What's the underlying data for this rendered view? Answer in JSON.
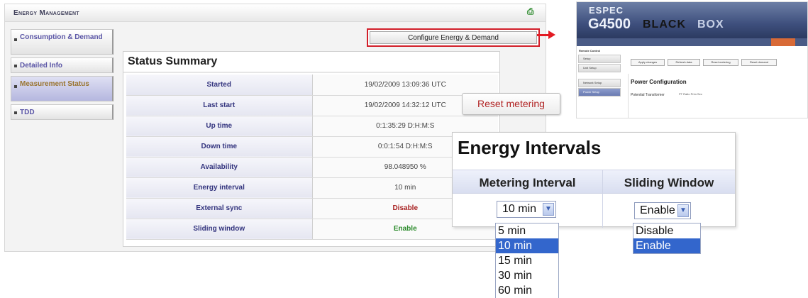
{
  "app": {
    "title": "Energy Management"
  },
  "sidebar": {
    "items": [
      {
        "label": "Consumption & Demand"
      },
      {
        "label": "Detailed Info"
      },
      {
        "label": "Measurement Status"
      },
      {
        "label": "TDD"
      }
    ]
  },
  "toolbar": {
    "configure_label": "Configure Energy & Demand"
  },
  "status_summary": {
    "title": "Status Summary",
    "rows": [
      {
        "label": "Started",
        "value": "19/02/2009 13:09:36 UTC"
      },
      {
        "label": "Last start",
        "value": "19/02/2009 14:32:12 UTC"
      },
      {
        "label": "Up time",
        "value": "0:1:35:29 D:H:M:S"
      },
      {
        "label": "Down time",
        "value": "0:0:1:54 D:H:M:S"
      },
      {
        "label": "Availability",
        "value": "98.048950 %"
      },
      {
        "label": "Energy interval",
        "value": "10 min"
      },
      {
        "label": "External sync",
        "value": "Disable"
      },
      {
        "label": "Sliding window",
        "value": "Enable"
      }
    ]
  },
  "reset_callout": {
    "label": "Reset metering"
  },
  "blackbox": {
    "brand": "ESPEC",
    "model": "G4500",
    "product_a": "BLACK",
    "product_b": "BOX",
    "sidebar_title": "Remote Control",
    "sidebar_items": [
      "Setup",
      "Unit Setup",
      "Network Setup",
      "Power Setup"
    ],
    "buttons": [
      "Apply changes",
      "Refresh data",
      "Reset metering",
      "Reset demand"
    ],
    "section_title": "Power Configuration",
    "field_label": "Potential Transformer",
    "field_extra": "PT Ratio   Prim   Sec"
  },
  "energy_intervals": {
    "title": "Energy Intervals",
    "metering_header": "Metering Interval",
    "sliding_header": "Sliding Window",
    "metering_value": "10 min",
    "sliding_value": "Enable",
    "metering_options": [
      "5 min",
      "10 min",
      "15 min",
      "30 min",
      "60 min"
    ],
    "sliding_options": [
      "Disable",
      "Enable"
    ],
    "arrow_icon": "chevron-down-icon"
  },
  "colors": {
    "callout_red": "#e31b23",
    "selected_blue": "#3366cc",
    "disable_red": "#a82222",
    "enable_green": "#2a8a2a"
  }
}
